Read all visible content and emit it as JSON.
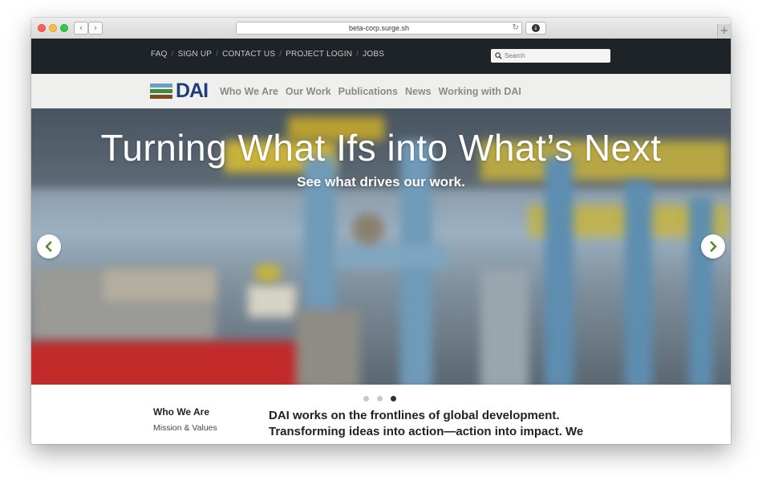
{
  "browser": {
    "url": "beta-corp.surge.sh",
    "back_glyph": "‹",
    "forward_glyph": "›",
    "reload_glyph": "↻",
    "download_glyph": "↓",
    "newtab_glyph": "+"
  },
  "utility_nav": {
    "links": [
      "FAQ",
      "SIGN UP",
      "CONTACT US",
      "PROJECT LOGIN",
      "JOBS"
    ],
    "separator": "/",
    "search_placeholder": "Search",
    "search_icon": "search-icon"
  },
  "main_nav": {
    "logo_text": "DAI",
    "logo_colors": [
      "#6aa0c8",
      "#3c8a3c",
      "#7a4a1e"
    ],
    "items": [
      "Who We Are",
      "Our Work",
      "Publications",
      "News",
      "Working with DAI"
    ]
  },
  "hero": {
    "title": "Turning What Ifs into What’s Next",
    "subtitle": "See what drives our work.",
    "prev_icon": "chevron-left-icon",
    "next_icon": "chevron-right-icon",
    "arrow_color": "#4a8a2a",
    "slide_count": 3,
    "active_slide": 3
  },
  "content": {
    "sidebar_title": "Who We Are",
    "sidebar_item": "Mission & Values",
    "lead_line1": "DAI works on the frontlines of global development.",
    "lead_line2": "Transforming ideas into action—action into impact. We"
  }
}
